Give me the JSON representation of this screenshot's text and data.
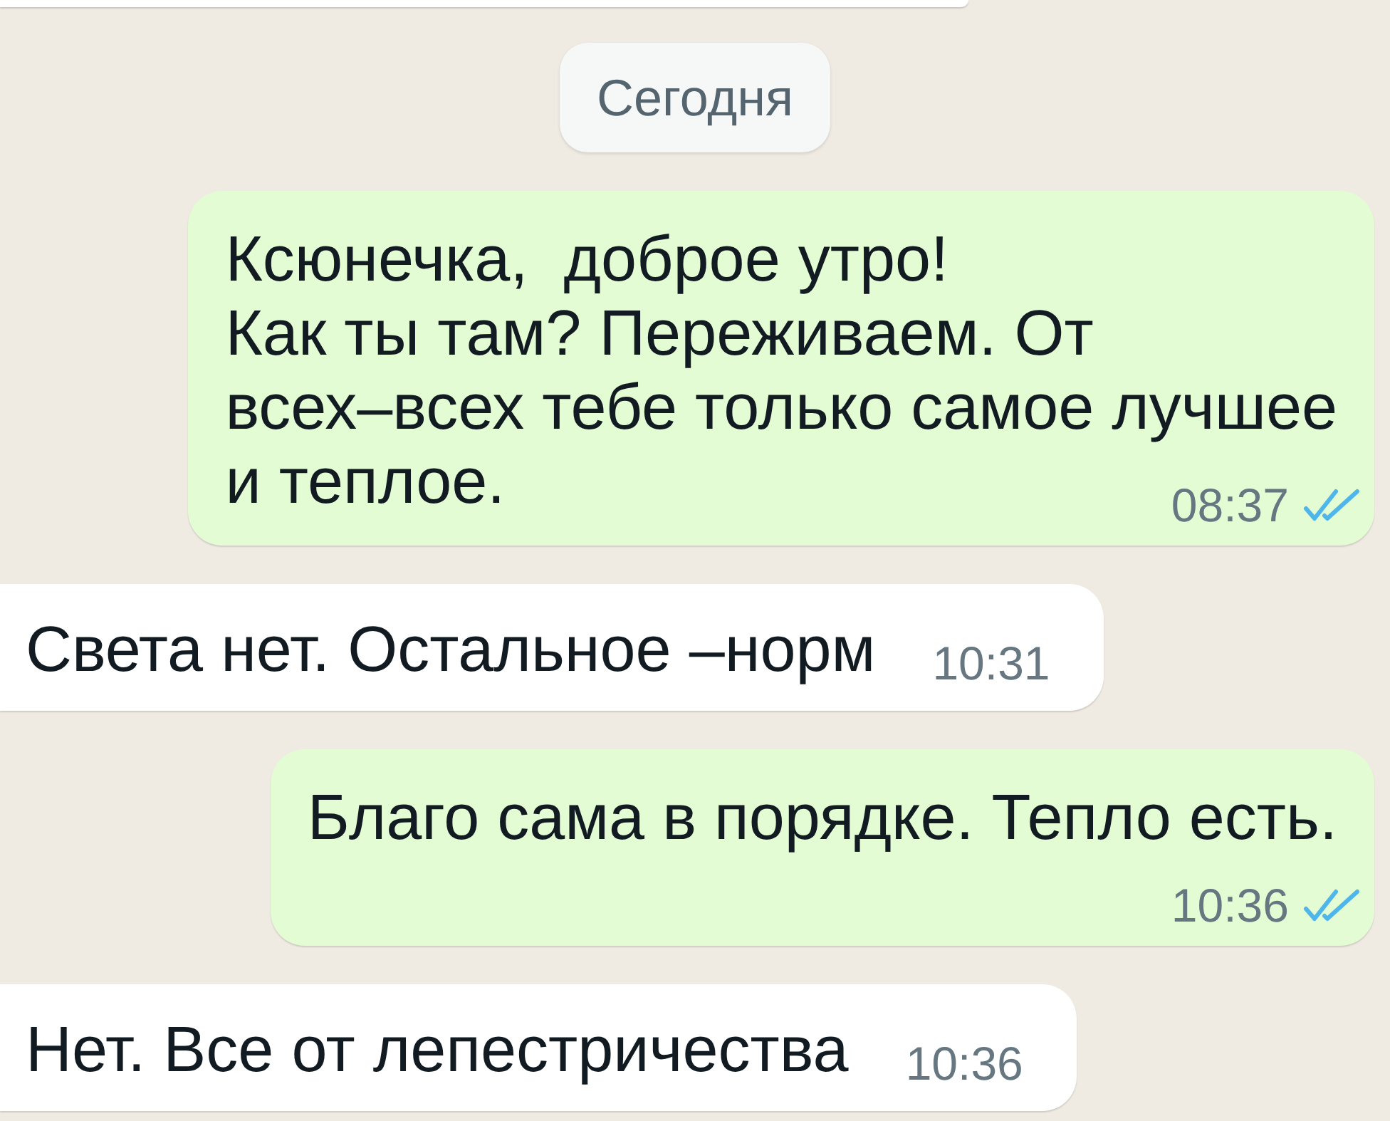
{
  "date_chip": "Сегодня",
  "messages": [
    {
      "kind": "outgoing",
      "text": "Ксюнечка,  доброе утро!\nКак ты там? Переживаем. От\nвсех–всех тебе только самое лучшее\nи теплое.",
      "time": "08:37",
      "read": true
    },
    {
      "kind": "incoming",
      "text": "Света нет. Остальное –норм",
      "time": "10:31"
    },
    {
      "kind": "outgoing",
      "text": "Благо сама в порядке. Тепло есть.",
      "time": "10:36",
      "read": true
    },
    {
      "kind": "incoming",
      "text": "Нет. Все от лепестричества",
      "time": "10:36"
    }
  ]
}
